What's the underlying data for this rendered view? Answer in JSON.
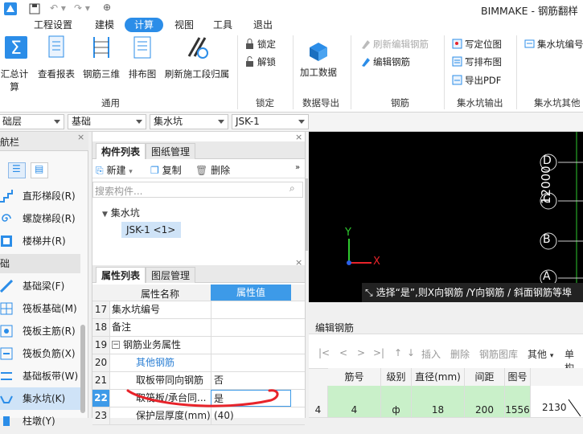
{
  "app_title": "BIMMAKE - 钢筋翻样",
  "menus": [
    "工程设置",
    "建模",
    "计算",
    "视图",
    "工具",
    "退出"
  ],
  "ribbon": {
    "calc": [
      "汇总计算",
      "查看报表",
      "钢筋三维",
      "排布图",
      "刷新施工段归属"
    ],
    "common_group": "通用",
    "lock": [
      "锁定",
      "解锁"
    ],
    "lock_group": "锁定",
    "export": "加工数据",
    "export_group": "数据导出",
    "rebar": [
      "刷新编辑钢筋",
      "编辑钢筋"
    ],
    "rebar_group": "钢筋",
    "pit": [
      "写定位图",
      "写排布图",
      "导出PDF"
    ],
    "pit_group": "集水坑输出",
    "pit_code": "集水坑编号",
    "other_group": "集水坑其他"
  },
  "combos": [
    "础层",
    "基础",
    "集水坑",
    "JSK-1"
  ],
  "nav": {
    "title": "航栏",
    "items": [
      "直形梯段(R)",
      "螺旋梯段(R)",
      "楼梯井(R)"
    ],
    "section": "础",
    "items2": [
      "基础梁(F)",
      "筏板基础(M)",
      "筏板主筋(R)",
      "筏板负筋(X)",
      "基础板带(W)",
      "集水坑(K)",
      "柱墩(Y)"
    ]
  },
  "component": {
    "tabs": [
      "构件列表",
      "图纸管理"
    ],
    "new": "新建",
    "copy": "复制",
    "delete": "删除",
    "search_placeholder": "搜索构件...",
    "tree_root": "集水坑",
    "tree_child": "JSK-1 <1>"
  },
  "props": {
    "tabs": [
      "属性列表",
      "图层管理"
    ],
    "header_name": "属性名称",
    "header_value": "属性值",
    "rows": [
      {
        "n": "17",
        "k": "集水坑编号",
        "v": ""
      },
      {
        "n": "18",
        "k": "备注",
        "v": ""
      },
      {
        "n": "19",
        "k": "钢筋业务属性",
        "v": ""
      },
      {
        "n": "20",
        "k": "其他钢筋",
        "v": ""
      },
      {
        "n": "21",
        "k": "取板带同向钢筋",
        "v": "否"
      },
      {
        "n": "22",
        "k": "取筏板/承台同...",
        "v": "是"
      },
      {
        "n": "23",
        "k": "保护层厚度(mm)",
        "v": "(40)"
      }
    ]
  },
  "canvas": {
    "axis_labels": [
      "D",
      "C",
      "B",
      "A"
    ],
    "dimension": "12000",
    "x_axis": "X",
    "y_axis": "Y",
    "hint": "选择“是”,则X向钢筋 /Y向钢筋 / 斜面钢筋等埠"
  },
  "edit": {
    "title": "编辑钢筋",
    "toolbar": [
      "插入",
      "删除",
      "钢筋图库",
      "其他",
      "单构"
    ],
    "columns": [
      "筋号",
      "级别",
      "直径(mm)",
      "间距",
      "图号"
    ],
    "row": {
      "n": "4",
      "no": "4",
      "grade": "ф",
      "dia": "18",
      "space": "200",
      "fig": "1556",
      "len": "2130"
    }
  },
  "colors": {
    "accent": "#2b8de8",
    "highlight": "#c9f0c9",
    "selected": "#cfe3f7",
    "annotation": "#e8232a"
  }
}
